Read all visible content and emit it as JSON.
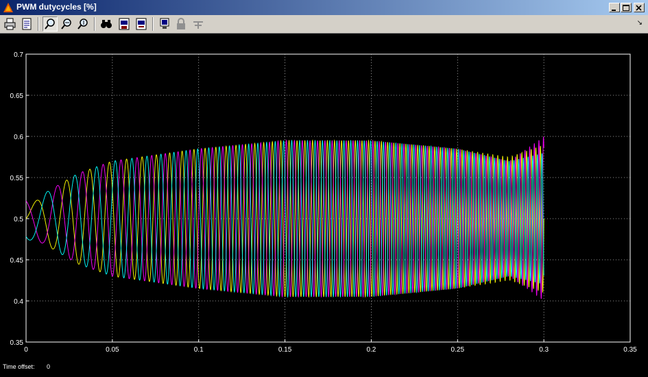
{
  "window": {
    "title": "PWM dutycycles [%]"
  },
  "toolbar": {
    "buttons": [
      {
        "name": "print-icon",
        "pressed": false
      },
      {
        "name": "parameters-icon",
        "pressed": false
      },
      {
        "name": "zoom-icon",
        "pressed": true
      },
      {
        "name": "zoom-x-icon",
        "pressed": false
      },
      {
        "name": "zoom-y-icon",
        "pressed": false
      },
      {
        "name": "autoscale-icon",
        "pressed": false
      },
      {
        "name": "save-axes-icon",
        "pressed": false
      },
      {
        "name": "restore-axes-icon",
        "pressed": false
      },
      {
        "name": "floating-scope-icon",
        "pressed": false
      },
      {
        "name": "lock-axes-icon",
        "pressed": false
      },
      {
        "name": "signal-selection-icon",
        "pressed": false
      }
    ]
  },
  "status": {
    "label": "Time offset:",
    "value": "0"
  },
  "colors": {
    "yellow": "#ffff00",
    "magenta": "#ff00ff",
    "cyan": "#00ffff",
    "background": "#000000",
    "grid": "#c0c0c0"
  },
  "chart_data": {
    "type": "line",
    "title": "",
    "xlabel": "",
    "ylabel": "",
    "xlim": [
      0,
      0.35
    ],
    "ylim": [
      0.35,
      0.7
    ],
    "xticks": [
      "0",
      "0.05",
      "0.1",
      "0.15",
      "0.2",
      "0.25",
      "0.3",
      "0.35"
    ],
    "yticks": [
      "0.35",
      "0.4",
      "0.45",
      "0.5",
      "0.55",
      "0.6",
      "0.65",
      "0.7"
    ],
    "grid": true,
    "legend": "none",
    "series": [
      {
        "color": "#ffff00",
        "phase_deg": 0,
        "t": [
          0,
          0.01,
          0.03,
          0.05,
          0.1,
          0.15,
          0.2,
          0.25,
          0.28,
          0.3
        ],
        "amplitude": [
          0.01,
          0.03,
          0.055,
          0.07,
          0.085,
          0.095,
          0.095,
          0.085,
          0.075,
          0.09
        ]
      },
      {
        "color": "#ff00ff",
        "phase_deg": 120,
        "t": [
          0,
          0.01,
          0.03,
          0.05,
          0.1,
          0.15,
          0.2,
          0.25,
          0.28,
          0.3
        ],
        "amplitude": [
          0.025,
          0.03,
          0.055,
          0.07,
          0.085,
          0.095,
          0.095,
          0.085,
          0.07,
          0.1
        ]
      },
      {
        "color": "#00ffff",
        "phase_deg": 240,
        "t": [
          0,
          0.01,
          0.03,
          0.05,
          0.1,
          0.15,
          0.2,
          0.25,
          0.28,
          0.3
        ],
        "amplitude": [
          0.025,
          0.03,
          0.055,
          0.07,
          0.085,
          0.095,
          0.095,
          0.085,
          0.07,
          0.08
        ]
      }
    ],
    "center": 0.5,
    "frequency_hz": {
      "start": 40,
      "end": 380
    },
    "t_end": 0.3
  }
}
